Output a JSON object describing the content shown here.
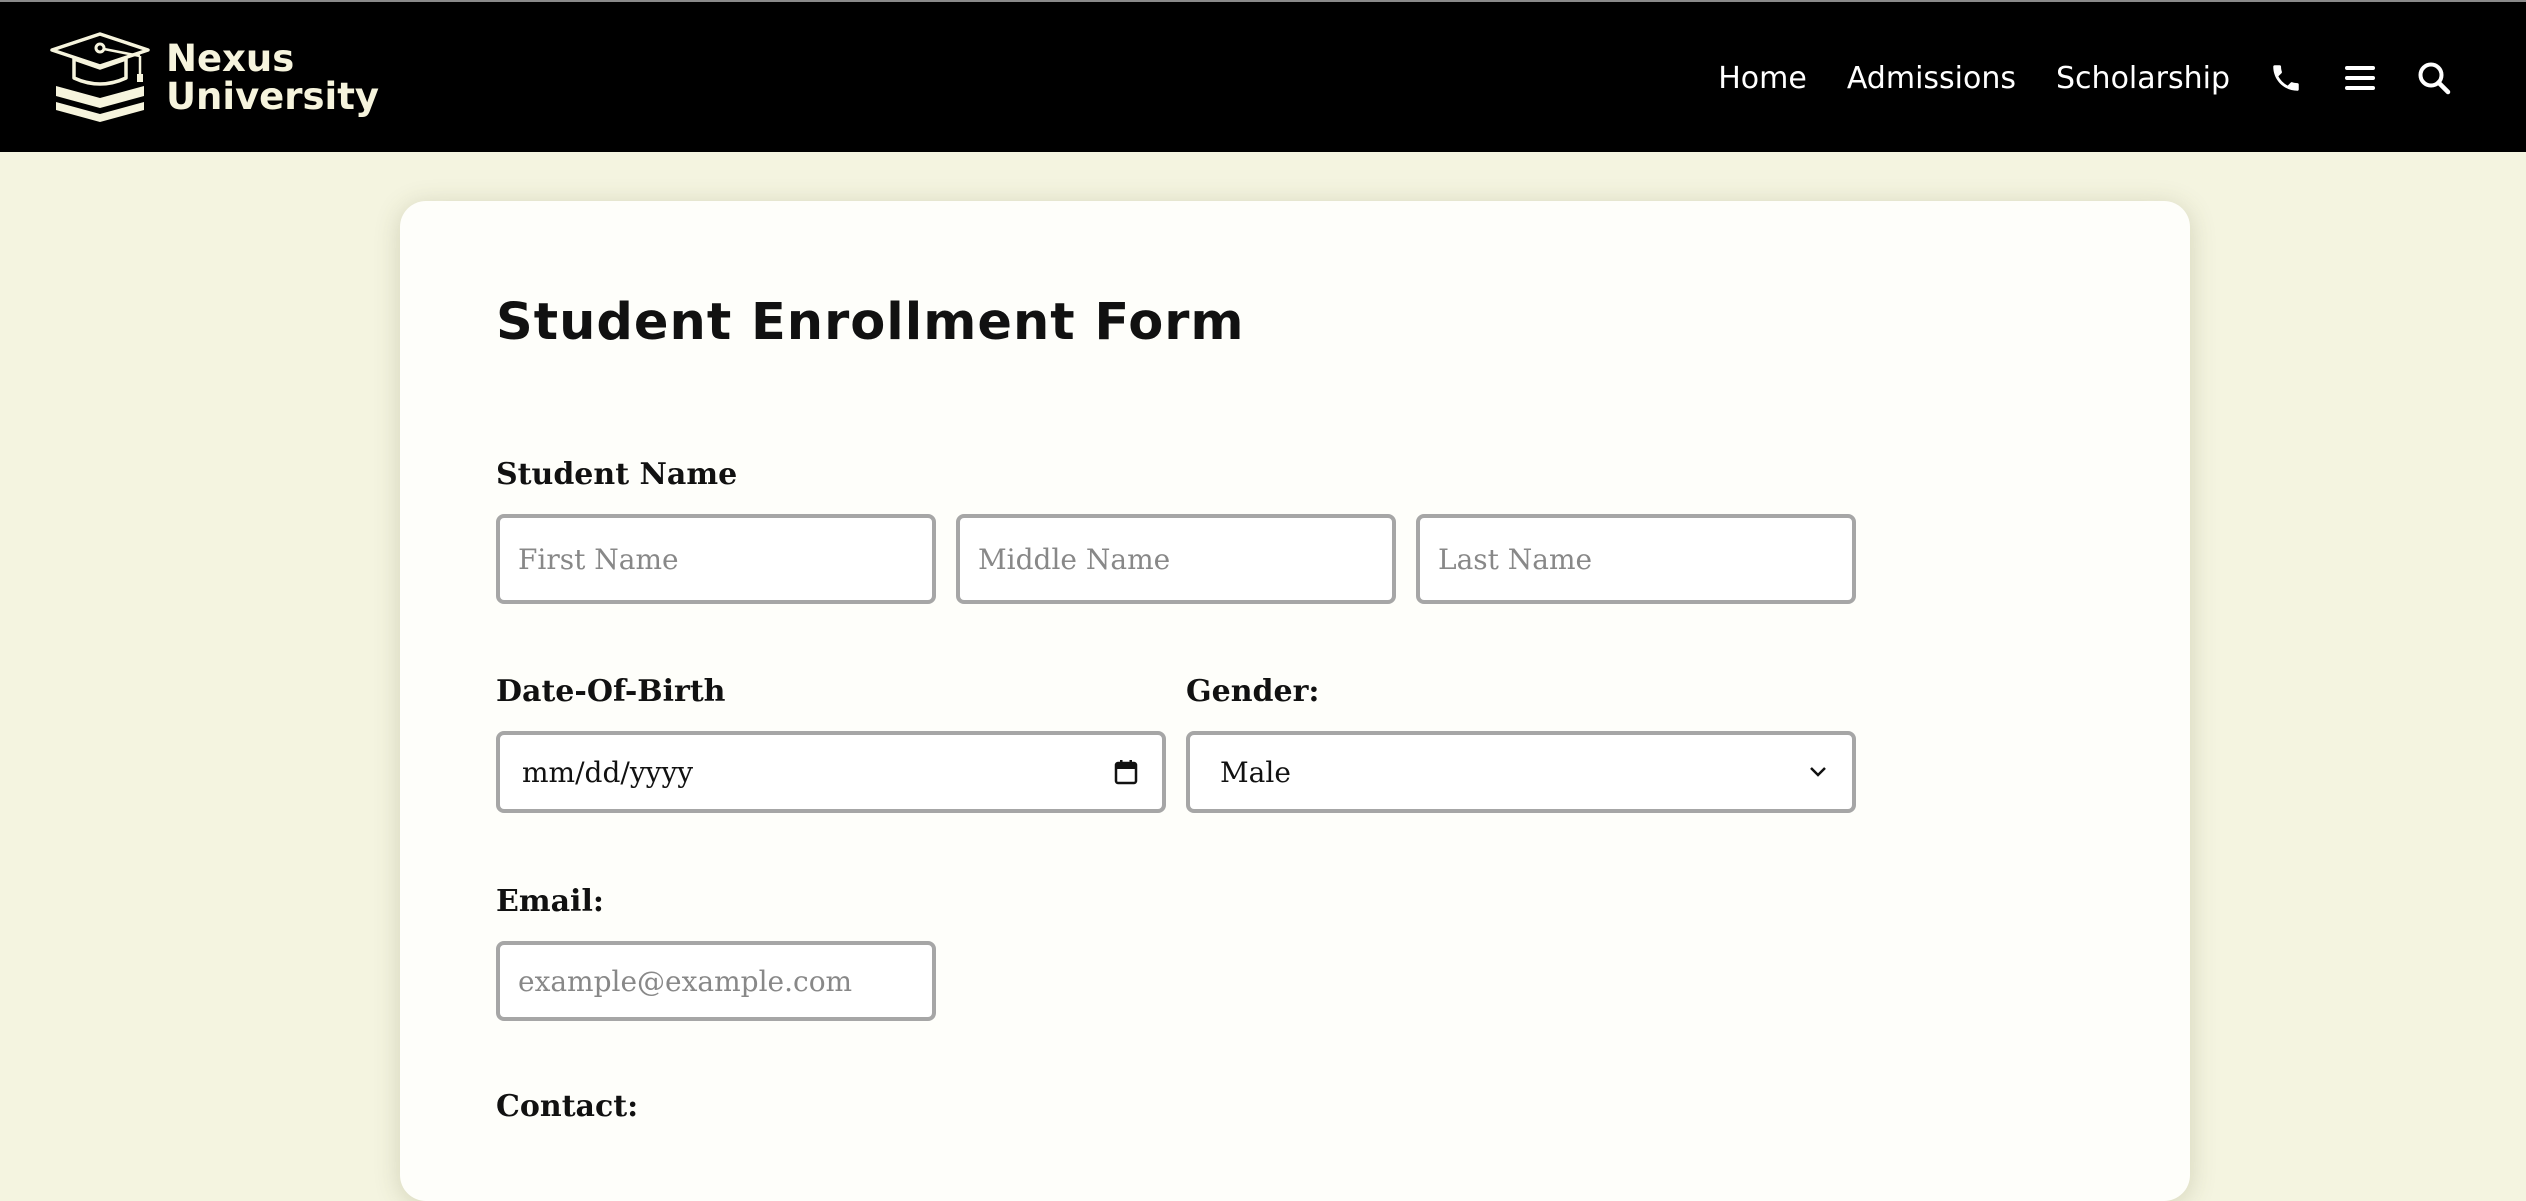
{
  "brand": {
    "line1": "Nexus",
    "line2": "University",
    "logo_icon": "graduation-cap-books-icon"
  },
  "nav": {
    "links": [
      "Home",
      "Admissions",
      "Scholarship"
    ],
    "icons": [
      "phone-icon",
      "menu-icon",
      "search-icon"
    ]
  },
  "form": {
    "title": "Student Enrollment Form",
    "student_name": {
      "label": "Student Name",
      "first_placeholder": "First Name",
      "middle_placeholder": "Middle Name",
      "last_placeholder": "Last Name"
    },
    "dob": {
      "label": "Date-Of-Birth",
      "placeholder": "mm/dd/yyyy",
      "icon": "calendar-icon"
    },
    "gender": {
      "label": "Gender:",
      "selected": "Male",
      "icon": "chevron-down-icon"
    },
    "email": {
      "label": "Email:",
      "placeholder": "example@example.com"
    },
    "contact": {
      "label": "Contact:"
    }
  },
  "colors": {
    "page_background": "#f4f4e0",
    "navbar_background": "#000000",
    "card_background": "#fefefa",
    "input_border": "#a6a6a6",
    "brand_text": "#f6f4dd"
  }
}
